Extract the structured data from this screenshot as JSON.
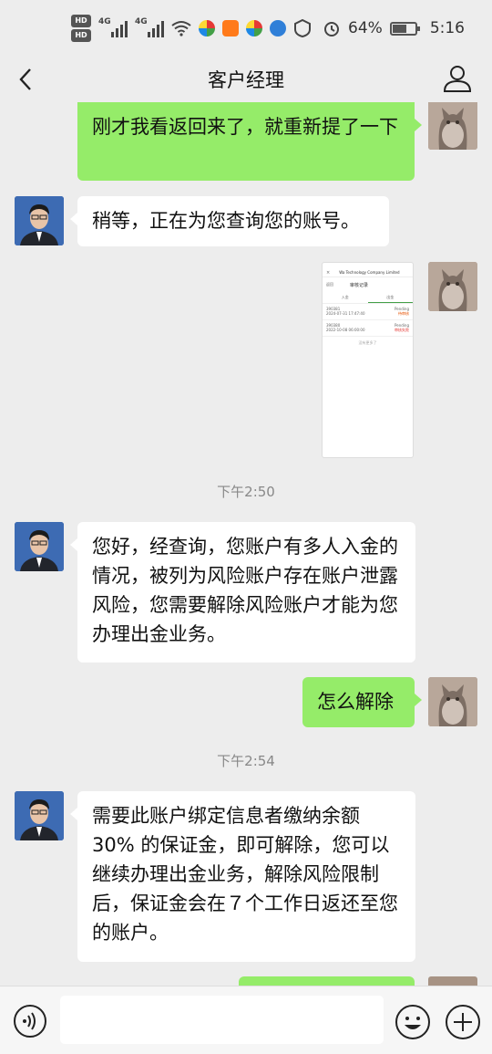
{
  "status_bar": {
    "hd1": "HD",
    "hd2": "HD",
    "net1": "4G",
    "net2": "4G",
    "battery_pct": "64%",
    "time": "5:16"
  },
  "header": {
    "title": "客户经理"
  },
  "messages": [
    {
      "side": "right",
      "type": "text",
      "text": "刚才我看返回来了，就重新提了一下"
    },
    {
      "side": "left",
      "type": "text",
      "text": "稍等，正在为您查询您的账号。"
    },
    {
      "side": "right",
      "type": "image",
      "image": {
        "company": "Wa Technology Company Limited",
        "back": "返回",
        "page_title": "审核记录",
        "tab_in": "入金",
        "tab_out": "出金",
        "rows": [
          {
            "id": "390381",
            "date": "2024-07-31 17:47:40",
            "status": "Pending",
            "amount": "待审核"
          },
          {
            "id": "390380",
            "date": "2022-10-08 06:00:00",
            "status": "Pending",
            "amount": "审核失败"
          }
        ],
        "footer": "没有更多了"
      }
    },
    {
      "type": "time",
      "text": "下午2:50"
    },
    {
      "side": "left",
      "type": "text",
      "text": "您好，经查询，您账户有多人入金的情况，被列为风险账户存在账户泄露风险，您需要解除风险账户才能为您办理出金业务。"
    },
    {
      "side": "right",
      "type": "text",
      "text": "怎么解除"
    },
    {
      "type": "time",
      "text": "下午2:54"
    },
    {
      "side": "left",
      "type": "text",
      "text": "需要此账户绑定信息者缴纳余额30% 的保证金，即可解除，您可以继续办理出金业务，解除风险限制后，保证金会在７个工作日返还至您的账户。"
    }
  ],
  "input_bar": {
    "voice_icon": "voice-icon",
    "emoji_icon": "emoji-icon",
    "plus_icon": "plus-icon"
  },
  "colors": {
    "background": "#ededed",
    "bubble_self": "#95ec69",
    "bubble_other": "#ffffff"
  }
}
